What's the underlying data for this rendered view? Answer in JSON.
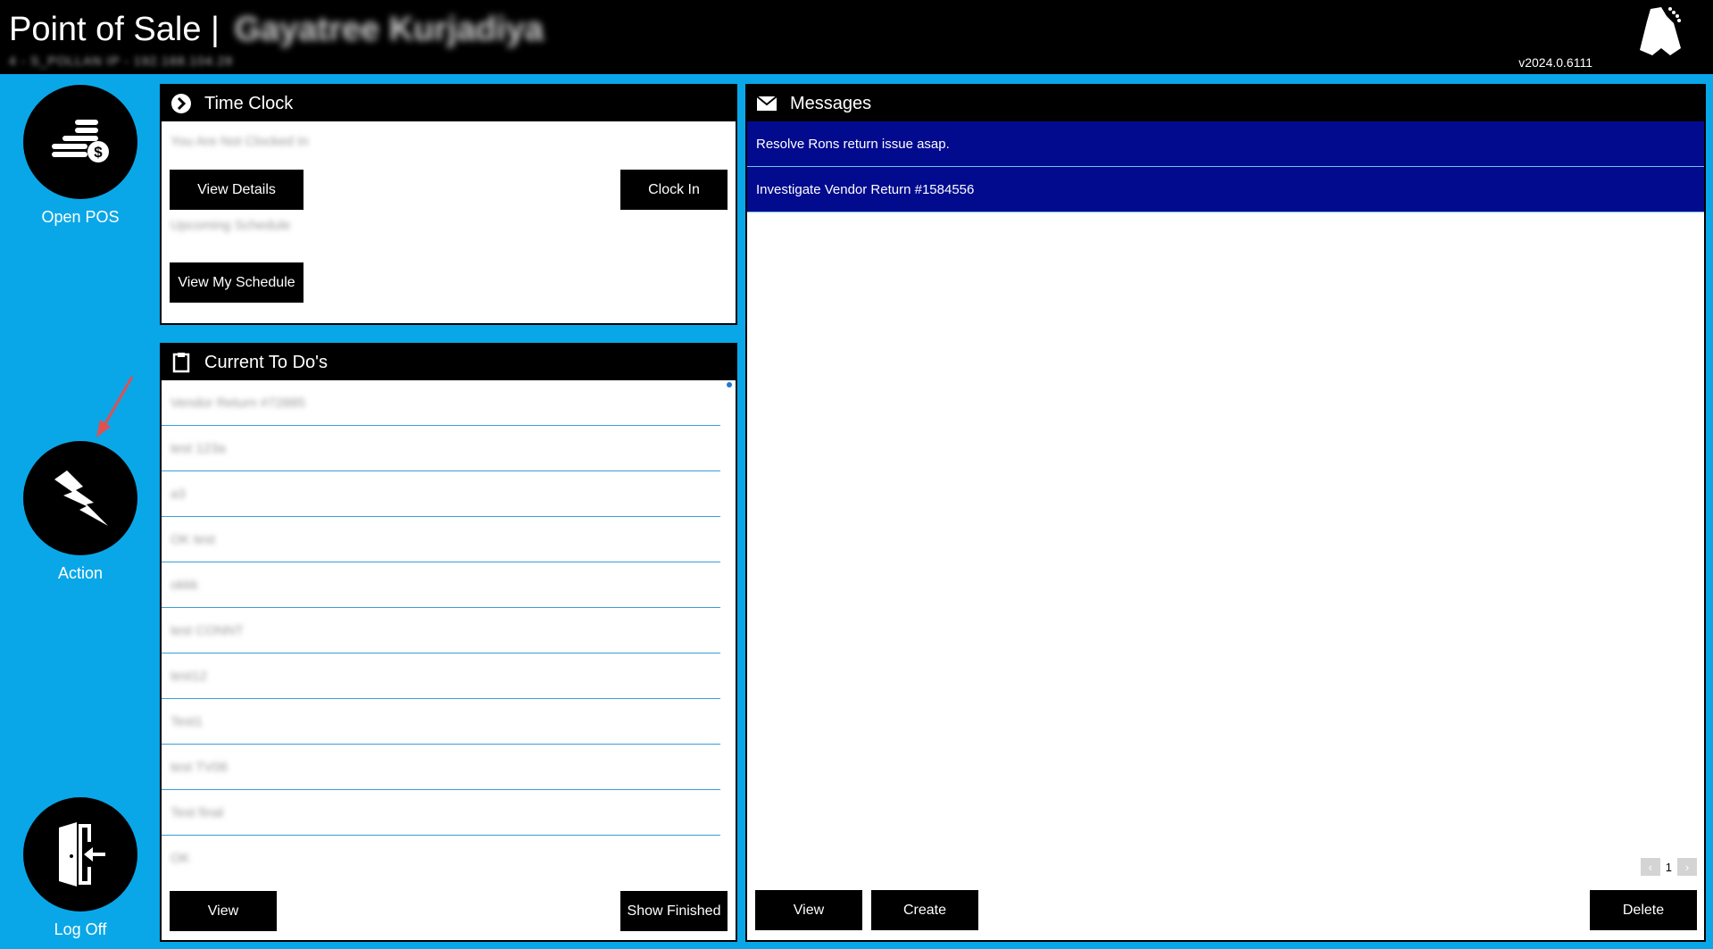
{
  "header": {
    "title": "Point of Sale |",
    "user_name": "Gayatree Kurjadiya",
    "sub_info": "4 - S_POLLAN IP - 192.168.104.28",
    "version": "v2024.0.6111"
  },
  "nav": [
    {
      "label": "Open POS",
      "icon": "coins-dollar-icon"
    },
    {
      "label": "Action",
      "icon": "lightning-bolt-icon"
    },
    {
      "label": "Log Off",
      "icon": "door-exit-icon"
    }
  ],
  "time_clock": {
    "title": "Time Clock",
    "status_text": "You Are Not Clocked In",
    "view_details_label": "View Details",
    "clock_in_label": "Clock In",
    "schedule_text": "Upcoming Schedule",
    "view_schedule_label": "View My Schedule"
  },
  "todos": {
    "title": "Current To Do's",
    "items": [
      "Vendor Return #72885",
      "test 123a",
      "a3",
      "OK test",
      "okkk",
      "test CONNT",
      "test12",
      "Test1",
      "test TV06",
      "Test final",
      "OK"
    ],
    "view_label": "View",
    "show_finished_label": "Show Finished"
  },
  "messages": {
    "title": "Messages",
    "items": [
      "Resolve Rons return issue asap.",
      "Investigate Vendor Return #1584556"
    ],
    "page": "1",
    "view_label": "View",
    "create_label": "Create",
    "delete_label": "Delete"
  },
  "colors": {
    "background": "#0aa7e8",
    "header": "#000000",
    "message_row": "#020a8e",
    "divider": "#3a9fd4"
  }
}
